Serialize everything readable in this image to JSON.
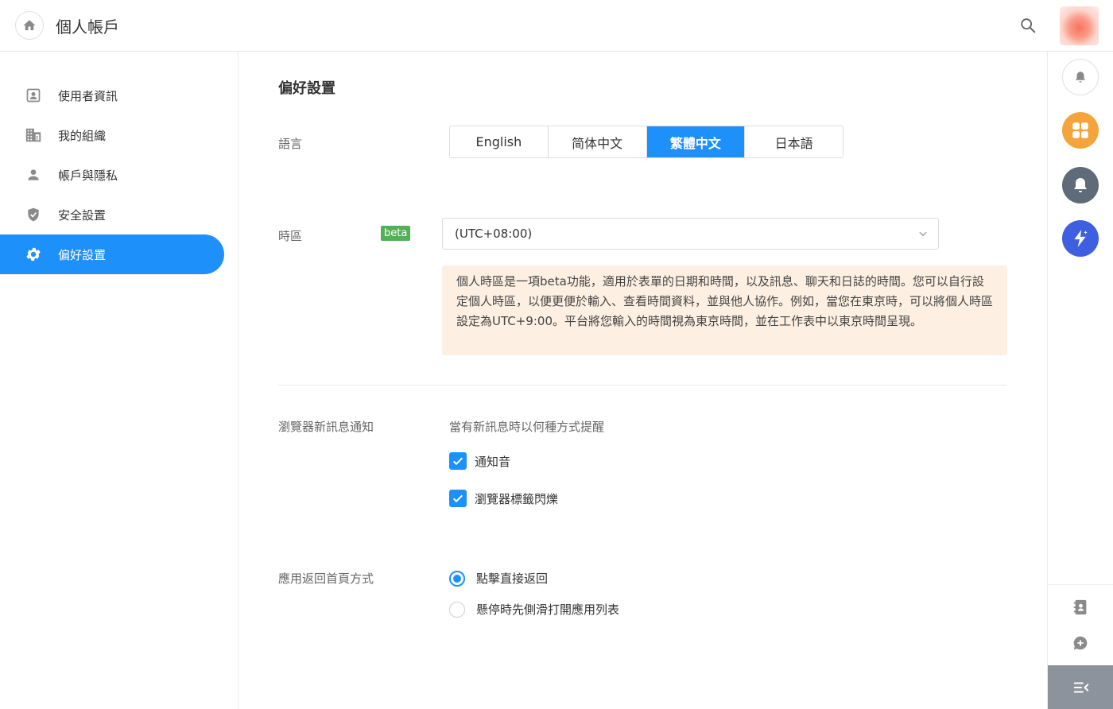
{
  "header": {
    "title": "個人帳戶",
    "home_icon": "home-icon",
    "search_icon": "search-icon"
  },
  "sidebar": {
    "items": [
      {
        "label": "使用者資訊",
        "icon": "user-card-icon",
        "active": false
      },
      {
        "label": "我的組織",
        "icon": "building-icon",
        "active": false
      },
      {
        "label": "帳戶與隱私",
        "icon": "person-icon",
        "active": false
      },
      {
        "label": "安全設置",
        "icon": "shield-icon",
        "active": false
      },
      {
        "label": "偏好設置",
        "icon": "gear-icon",
        "active": true
      }
    ]
  },
  "preferences": {
    "title": "偏好設置",
    "language": {
      "label": "語言",
      "options": [
        "English",
        "简体中文",
        "繁體中文",
        "日本語"
      ],
      "selected": "繁體中文"
    },
    "timezone": {
      "label": "時區",
      "badge": "beta",
      "value": "(UTC+08:00)",
      "note": "個人時區是一項beta功能，適用於表單的日期和時間，以及訊息、聊天和日誌的時間。您可以自行設定個人時區，以便更便於輸入、查看時間資料，並與他人協作。例如，當您在東京時，可以將個人時區設定為UTC+9:00。平台將您輸入的時間視為東京時間，並在工作表中以東京時間呈現。"
    },
    "browser_notify": {
      "label": "瀏覽器新訊息通知",
      "hint": "當有新訊息時以何種方式提醒",
      "options": [
        {
          "label": "通知音",
          "checked": true
        },
        {
          "label": "瀏覽器標籤閃爍",
          "checked": true
        }
      ]
    },
    "app_return": {
      "label": "應用返回首頁方式",
      "options": [
        {
          "label": "點擊直接返回",
          "selected": true
        },
        {
          "label": "懸停時先側滑打開應用列表",
          "selected": false
        }
      ]
    }
  },
  "right_rail": {
    "buttons": [
      "bell-icon",
      "apps-grid-icon",
      "bell-filled-icon",
      "lightning-icon"
    ],
    "bottom": [
      "contacts-icon",
      "add-chat-icon",
      "collapse-menu-icon"
    ]
  },
  "colors": {
    "accent": "#1e90fa",
    "beta": "#52b058",
    "note_bg": "#fdf0e2",
    "apps": "#f5a33b",
    "bell": "#5f6b78",
    "lightning": "#3d5fe0",
    "collapse_bg": "#8c939d"
  }
}
